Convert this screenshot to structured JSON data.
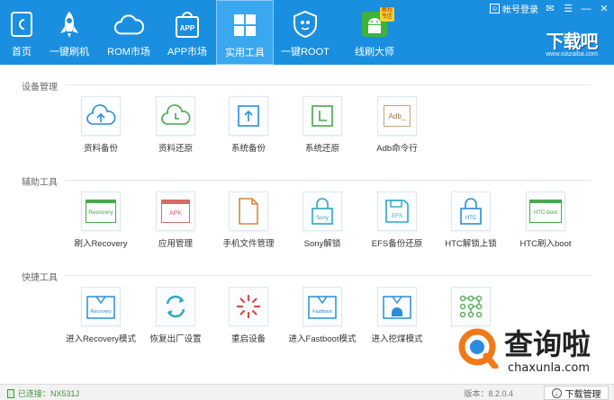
{
  "nav": {
    "items": [
      {
        "label": "首页",
        "icon": "home-icon"
      },
      {
        "label": "一键刷机",
        "icon": "rocket-icon"
      },
      {
        "label": "ROM市场",
        "icon": "cloud-icon"
      },
      {
        "label": "APP市场",
        "icon": "shopping-bag-icon"
      },
      {
        "label": "实用工具",
        "icon": "grid-icon"
      },
      {
        "label": "一键ROOT",
        "icon": "shield-icon"
      },
      {
        "label": "线刷大师",
        "icon": "android-icon"
      }
    ],
    "badge": "教程\n专区"
  },
  "topbar": {
    "login_label": "帐号登录"
  },
  "logo": {
    "title": "下载吧",
    "subtitle": "www.xiazaiba.com"
  },
  "sections": [
    {
      "title": "设备管理",
      "tools": [
        {
          "label": "资料备份",
          "icon": "cloud-upload-icon",
          "color": "#2a8ed8"
        },
        {
          "label": "资料还原",
          "icon": "cloud-restore-icon",
          "color": "#4aa84a"
        },
        {
          "label": "系统备份",
          "icon": "system-backup-icon",
          "color": "#2a8ed8"
        },
        {
          "label": "系统还原",
          "icon": "system-restore-icon",
          "color": "#4aa84a"
        },
        {
          "label": "Adb命令行",
          "icon": "terminal-icon",
          "color": "#c8a47a",
          "inner": "Adb_"
        }
      ]
    },
    {
      "title": "辅助工具",
      "tools": [
        {
          "label": "刷入Recovery",
          "icon": "recovery-folder-icon",
          "color": "#4aa84a",
          "inner": "Recovery"
        },
        {
          "label": "应用管理",
          "icon": "apk-box-icon",
          "color": "#d86a6a",
          "inner": "APK"
        },
        {
          "label": "手机文件管理",
          "icon": "file-icon",
          "color": "#d88a3a"
        },
        {
          "label": "Sony解锁",
          "icon": "lock-icon",
          "color": "#2aa8c8",
          "inner": "Sony"
        },
        {
          "label": "EFS备份还原",
          "icon": "efs-disk-icon",
          "color": "#2aa8c8",
          "inner": "EFS"
        },
        {
          "label": "HTC解锁上锁",
          "icon": "lock-icon",
          "color": "#2a8ed8",
          "inner": "HTC"
        },
        {
          "label": "HTC刷入boot",
          "icon": "boot-folder-icon",
          "color": "#4aa84a",
          "inner": "HTC-boot"
        }
      ]
    },
    {
      "title": "快捷工具",
      "tools": [
        {
          "label": "进入Recovery模式",
          "icon": "recovery-download-icon",
          "color": "#2a8ed8",
          "inner": "Recovery"
        },
        {
          "label": "恢复出厂设置",
          "icon": "refresh-icon",
          "color": "#2aa8c8"
        },
        {
          "label": "重启设备",
          "icon": "loading-icon",
          "color": "#d84a4a"
        },
        {
          "label": "进入Fastboot模式",
          "icon": "fastboot-icon",
          "color": "#2a8ed8",
          "inner": "Fastboot"
        },
        {
          "label": "进入挖煤模式",
          "icon": "android-download-icon",
          "color": "#2a8ed8"
        },
        {
          "label": "",
          "icon": "pattern-lock-icon",
          "color": "#4aa84a"
        }
      ]
    }
  ],
  "status": {
    "connection": "已连接：NX531J",
    "version": "版本：8.2.0.4",
    "download_label": "下载管理"
  },
  "watermark": {
    "text": "查询啦",
    "sub": "chaxunla.com"
  },
  "colors": {
    "header_bg": "#1a8fe0",
    "active_nav": "#3ba7ee"
  }
}
